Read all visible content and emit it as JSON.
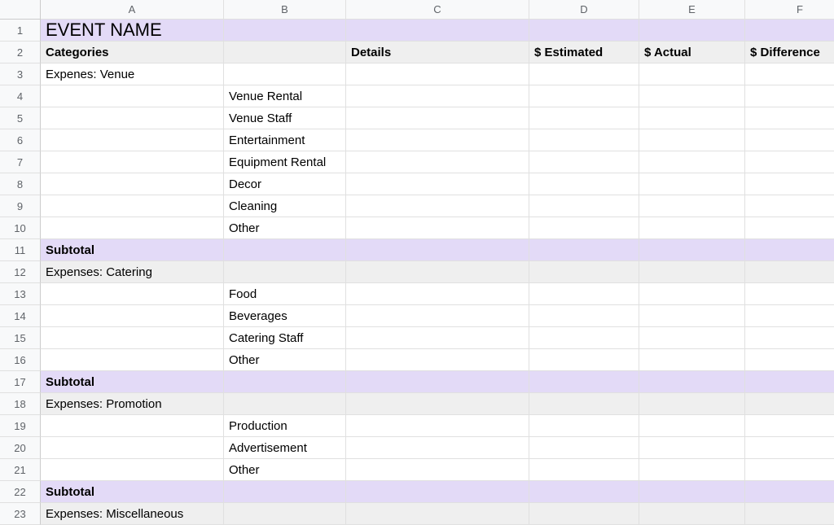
{
  "columns": [
    "A",
    "B",
    "C",
    "D",
    "E",
    "F"
  ],
  "rowCount": 23,
  "title": "EVENT NAME",
  "headers": {
    "categories": "Categories",
    "details": "Details",
    "estimated": "$ Estimated",
    "actual": "$ Actual",
    "difference": "$ Difference"
  },
  "labels": {
    "subtotal": "Subtotal"
  },
  "sections": {
    "venue": {
      "name": "Expenes: Venue",
      "items": [
        "Venue Rental",
        "Venue Staff",
        "Entertainment",
        "Equipment Rental",
        "Decor",
        "Cleaning",
        "Other"
      ]
    },
    "catering": {
      "name": "Expenses: Catering",
      "items": [
        "Food",
        "Beverages",
        "Catering Staff",
        "Other"
      ]
    },
    "promotion": {
      "name": "Expenses: Promotion",
      "items": [
        "Production",
        "Advertisement",
        "Other"
      ]
    },
    "misc": {
      "name": "Expenses: Miscellaneous"
    }
  },
  "chart_data": {
    "type": "table",
    "title": "EVENT NAME",
    "columns": [
      "Categories",
      "",
      "Details",
      "$ Estimated",
      "$ Actual",
      "$ Difference"
    ],
    "rows": [
      [
        "Expenes: Venue",
        "",
        "",
        "",
        "",
        ""
      ],
      [
        "",
        "Venue Rental",
        "",
        "",
        "",
        ""
      ],
      [
        "",
        "Venue Staff",
        "",
        "",
        "",
        ""
      ],
      [
        "",
        "Entertainment",
        "",
        "",
        "",
        ""
      ],
      [
        "",
        "Equipment Rental",
        "",
        "",
        "",
        ""
      ],
      [
        "",
        "Decor",
        "",
        "",
        "",
        ""
      ],
      [
        "",
        "Cleaning",
        "",
        "",
        "",
        ""
      ],
      [
        "",
        "Other",
        "",
        "",
        "",
        ""
      ],
      [
        "Subtotal",
        "",
        "",
        "",
        "",
        ""
      ],
      [
        "Expenses: Catering",
        "",
        "",
        "",
        "",
        ""
      ],
      [
        "",
        "Food",
        "",
        "",
        "",
        ""
      ],
      [
        "",
        "Beverages",
        "",
        "",
        "",
        ""
      ],
      [
        "",
        "Catering Staff",
        "",
        "",
        "",
        ""
      ],
      [
        "",
        "Other",
        "",
        "",
        "",
        ""
      ],
      [
        "Subtotal",
        "",
        "",
        "",
        "",
        ""
      ],
      [
        "Expenses: Promotion",
        "",
        "",
        "",
        "",
        ""
      ],
      [
        "",
        "Production",
        "",
        "",
        "",
        ""
      ],
      [
        "",
        "Advertisement",
        "",
        "",
        "",
        ""
      ],
      [
        "",
        "Other",
        "",
        "",
        "",
        ""
      ],
      [
        "Subtotal",
        "",
        "",
        "",
        "",
        ""
      ],
      [
        "Expenses: Miscellaneous",
        "",
        "",
        "",
        "",
        ""
      ]
    ]
  }
}
